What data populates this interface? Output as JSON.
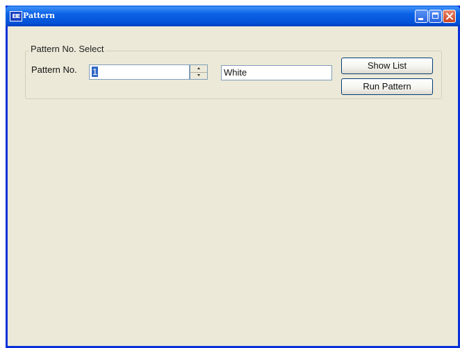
{
  "window": {
    "title": "Pattern",
    "icon": "app-logo-icon",
    "icon_text": "EIE",
    "controls": [
      "minimize-icon",
      "maximize-icon",
      "close-icon"
    ]
  },
  "group": {
    "legend": "Pattern No. Select"
  },
  "pattern": {
    "label": "Pattern No.",
    "value": "1",
    "name": "White"
  },
  "buttons": {
    "show_list": "Show List",
    "run_pattern": "Run Pattern"
  },
  "colors": {
    "titlebar": "#0a5ae0",
    "client_bg": "#ece9d8",
    "selection": "#316ac5"
  }
}
